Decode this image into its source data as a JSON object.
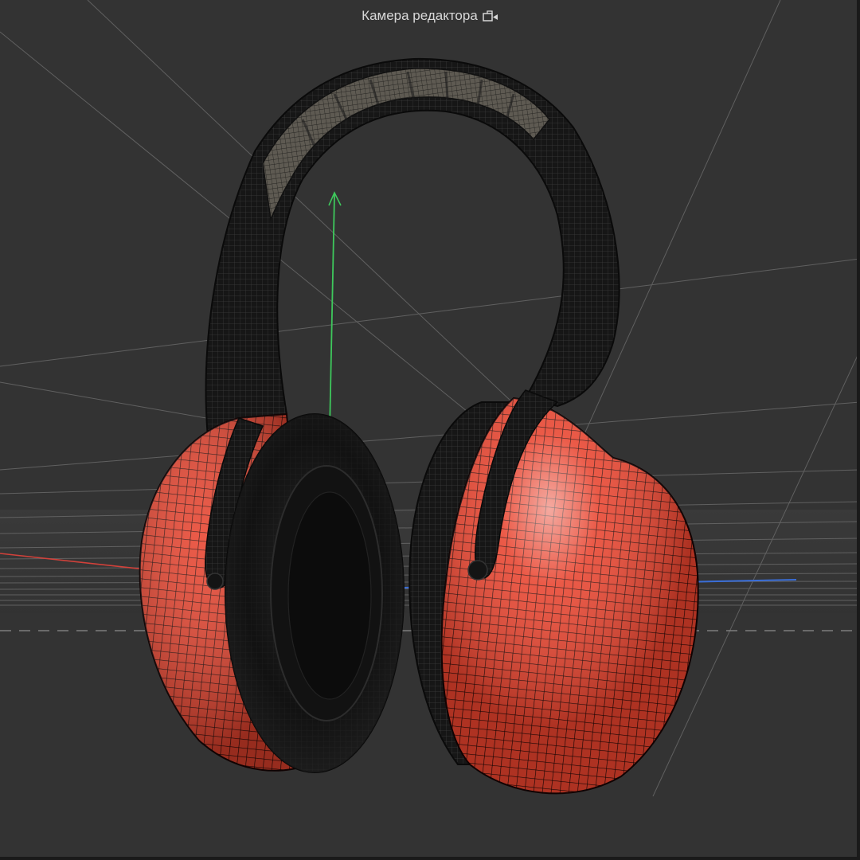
{
  "viewport": {
    "camera_label": "Камера редактора",
    "camera_icon": "camera-icon"
  },
  "scene": {
    "object": "headphones",
    "view": "wireframe-on-shaded",
    "axes": {
      "x_color": "#d2413a",
      "y_color": "#3ec85c",
      "z_color": "#3a6ed8"
    },
    "colors": {
      "background": "#333333",
      "earcup_shell": "#e8432e",
      "frame": "#161616",
      "headband_pad": "#5e5a52",
      "grid": "#6f6f6f",
      "ground": "#3c3c3c"
    }
  }
}
